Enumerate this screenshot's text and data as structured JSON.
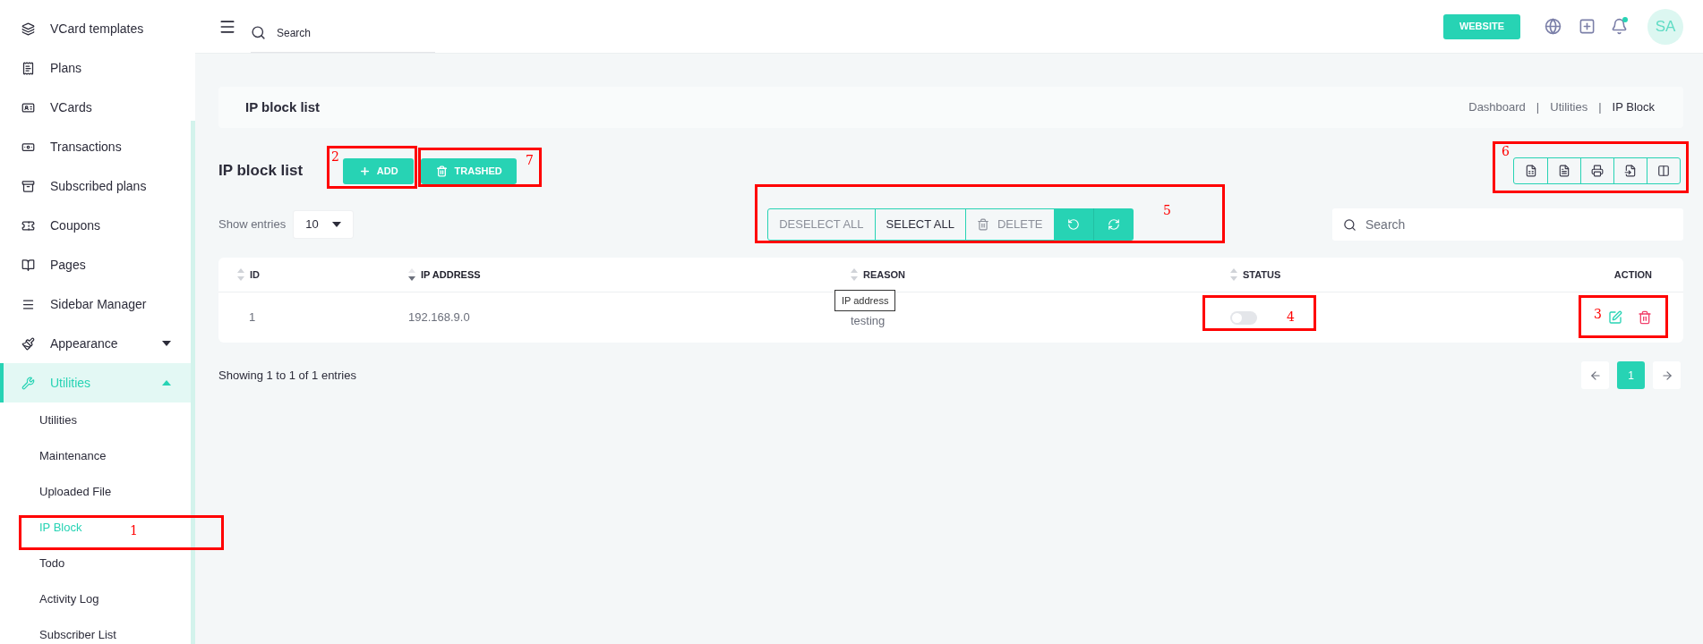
{
  "sidebar": {
    "items": [
      {
        "label": "VCard templates",
        "selected": false
      },
      {
        "label": "Plans",
        "selected": false
      },
      {
        "label": "VCards",
        "selected": false
      },
      {
        "label": "Transactions",
        "selected": false
      },
      {
        "label": "Subscribed plans",
        "selected": false
      },
      {
        "label": "Coupons",
        "selected": false
      },
      {
        "label": "Pages",
        "selected": false
      },
      {
        "label": "Sidebar Manager",
        "selected": false
      },
      {
        "label": "Appearance",
        "selected": false,
        "expanded": false
      },
      {
        "label": "Utilities",
        "selected": true,
        "expanded": true,
        "children": [
          {
            "label": "Utilities",
            "selected": false
          },
          {
            "label": "Maintenance",
            "selected": false
          },
          {
            "label": "Uploaded File",
            "selected": false
          },
          {
            "label": "IP Block",
            "selected": true
          },
          {
            "label": "Todo",
            "selected": false
          },
          {
            "label": "Activity Log",
            "selected": false
          },
          {
            "label": "Subscriber List",
            "selected": false
          }
        ]
      }
    ]
  },
  "topbar": {
    "search": {
      "placeholder": "Search"
    },
    "website_button": "WEBSITE",
    "notification_dot": true,
    "avatar": "SA"
  },
  "header": {
    "title": "IP block list",
    "breadcrumbs": [
      "Dashboard",
      "|",
      "Utilities",
      "|",
      "IP Block"
    ]
  },
  "toolbar": {
    "title": "IP block list",
    "add_button": "ADD",
    "trashed_button": "TRASHED"
  },
  "show_entries": {
    "label": "Show entries",
    "value": "10"
  },
  "bulk_actions": [
    {
      "label": "DESELECT ALL",
      "disabled": true
    },
    {
      "label": "SELECT ALL",
      "disabled": false
    },
    {
      "label": "DELETE",
      "disabled": true
    }
  ],
  "table_search": {
    "placeholder": "Search"
  },
  "table": {
    "columns": [
      {
        "label": "ID",
        "sortable": true,
        "sorted": false
      },
      {
        "label": "IP ADDRESS",
        "sortable": true,
        "sorted": true
      },
      {
        "label": "REASON",
        "sortable": true,
        "sorted": false
      },
      {
        "label": "STATUS",
        "sortable": true,
        "sorted": false
      },
      {
        "label": "ACTION",
        "sortable": false,
        "sorted": false
      }
    ],
    "rows": [
      {
        "id": "1",
        "ip": "192.168.9.0",
        "reason": "testing",
        "status_on": false
      }
    ]
  },
  "tooltip": "IP address",
  "footer": {
    "info": "Showing 1 to 1 of 1 entries",
    "pages": [
      {
        "label": "1",
        "selected": true
      }
    ]
  },
  "annotations": [
    {
      "number": "1"
    },
    {
      "number": "2"
    },
    {
      "number": "7"
    },
    {
      "number": "5"
    },
    {
      "number": "6"
    },
    {
      "number": "4"
    },
    {
      "number": "3"
    }
  ]
}
